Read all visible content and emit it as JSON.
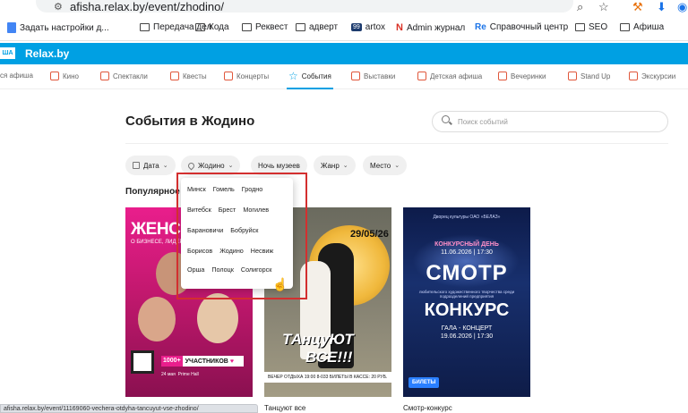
{
  "browser": {
    "url": "afisha.relax.by/event/zhodino/",
    "status_url": "afisha.relax.by/event/11169060-vechera-otdyha-tancuyut-vse-zhodino/"
  },
  "bookmarks": [
    {
      "label": "Задать настройки д...",
      "icon": "doc"
    },
    {
      "label": "Передача дел",
      "icon": "folder"
    },
    {
      "label": "Кода",
      "icon": "folder"
    },
    {
      "label": "Реквест",
      "icon": "folder"
    },
    {
      "label": "адверт",
      "icon": "folder"
    },
    {
      "label": "artox",
      "icon": "99"
    },
    {
      "label": "Admin журнал",
      "icon": "Re"
    },
    {
      "label": "Справочный центр",
      "icon": "Re"
    },
    {
      "label": "SEO",
      "icon": "folder"
    },
    {
      "label": "Афиша",
      "icon": "folder"
    }
  ],
  "site": {
    "logo_badge": "ША",
    "logo_text": "Relax.by"
  },
  "categories": [
    {
      "label": "ся афиша"
    },
    {
      "label": "Кино"
    },
    {
      "label": "Спектакли"
    },
    {
      "label": "Квесты"
    },
    {
      "label": "Концерты"
    },
    {
      "label": "События",
      "active": true
    },
    {
      "label": "Выставки"
    },
    {
      "label": "Детская афиша"
    },
    {
      "label": "Вечеринки"
    },
    {
      "label": "Stand Up"
    },
    {
      "label": "Экскурсии"
    }
  ],
  "page": {
    "title": "События в Жодино",
    "search_placeholder": "Поиск событий",
    "section_title": "Популярное"
  },
  "filters": {
    "date": "Дата",
    "city": "Жодино",
    "museum_night": "Ночь музеев",
    "genre": "Жанр",
    "place": "Место"
  },
  "city_dropdown": {
    "rows": [
      [
        "Минск",
        "Гомель",
        "Гродно"
      ],
      [
        "Витебск",
        "Брест",
        "Могилев"
      ],
      [
        "Барановичи",
        "Бобруйск"
      ],
      [
        "Борисов",
        "Жодино",
        "Несвиж"
      ],
      [
        "Орша",
        "Полоцк",
        "Солигорск"
      ]
    ]
  },
  "cards": [
    {
      "title": "",
      "poster": {
        "headline": "ЖЕНСКИ",
        "subline": "О БИЗНЕСЕ, ЛИДЕРСТ",
        "count_highlight": "1000+",
        "count_text": "УЧАСТНИКОВ",
        "date": "24 мая",
        "venue": "Prime Hall"
      }
    },
    {
      "title": "Танцуют все",
      "poster": {
        "date": "29/05/26",
        "headline1": "ТАнцуЮТ",
        "headline2": "ВСЕ!!!",
        "strip": "ВЕЧЕР ОТДЫХА   19:00   8-033   БИЛЕТЫ В КАССЕ: 20 РУБ."
      }
    },
    {
      "title": "Смотр-конкурс",
      "poster": {
        "top": "Дворец культуры ОАО «БЕЛАЗ»",
        "day": "КОНКУРСНЫЙ ДЕНЬ",
        "date1": "11.06.2026 | 17:30",
        "big1": "СМОТР",
        "mid": "любительского художественного творчества среди подразделений предприятия",
        "big2": "КОНКУРС",
        "gala": "ГАЛА - КОНЦЕРТ",
        "date2": "19.06.2026 | 17:30",
        "tickets": "БИЛЕТЫ"
      }
    }
  ],
  "colors": {
    "brand": "#00a0e3",
    "poster1": "#e91e8c",
    "annotation_frame": "#d32f2f"
  }
}
